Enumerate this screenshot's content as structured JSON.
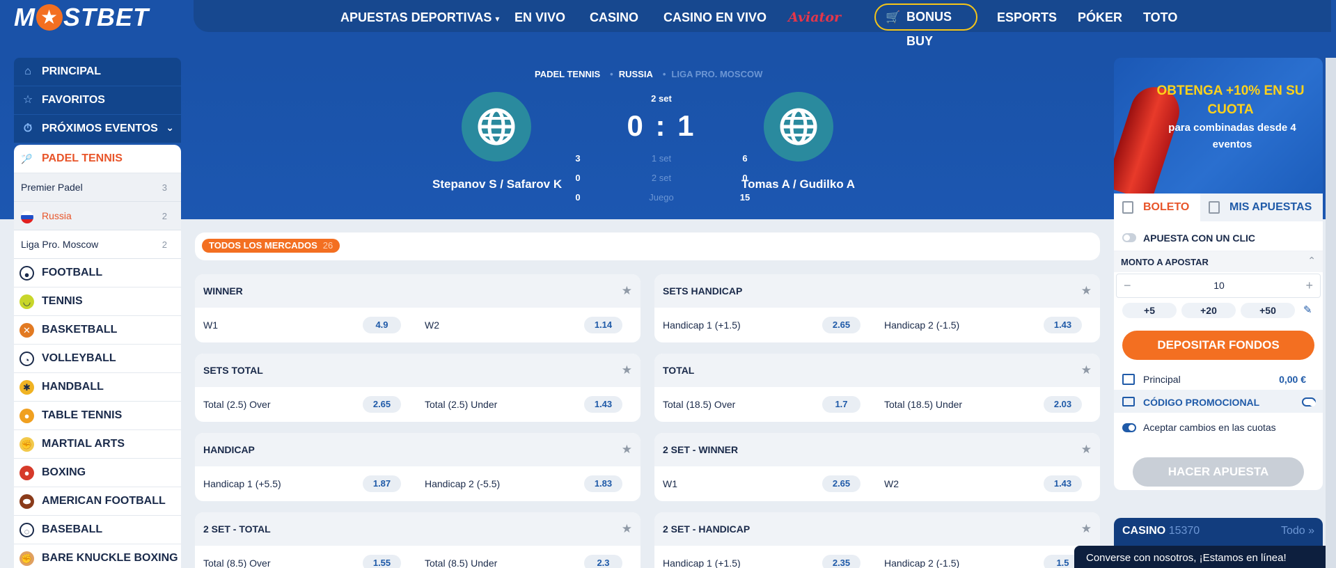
{
  "brand": {
    "logo_left": "M",
    "logo_right": "STBET",
    "accent": "#f36f21",
    "primary": "#1a52a8"
  },
  "nav": [
    {
      "label": "APUESTAS DEPORTIVAS",
      "chevron": "chevron-down-icon"
    },
    {
      "label": "EN VIVO"
    },
    {
      "label": "CASINO"
    },
    {
      "label": "CASINO EN VIVO"
    },
    {
      "label": "Aviator"
    },
    {
      "label": "BONUS BUY",
      "icon": "cart-icon"
    },
    {
      "label": "ESPORTS"
    },
    {
      "label": "PÓKER"
    },
    {
      "label": "TOTO"
    }
  ],
  "sidebar": {
    "top": [
      {
        "label": "PRINCIPAL",
        "icon": "home-icon"
      },
      {
        "label": "FAVORITOS",
        "icon": "star-icon"
      },
      {
        "label": "PRÓXIMOS EVENTOS",
        "icon": "stopwatch-icon"
      }
    ],
    "active_sport": "PADEL TENNIS",
    "sub": [
      {
        "label": "Premier Padel",
        "count": "3"
      },
      {
        "label": "Russia",
        "count": "2"
      },
      {
        "label": "Liga Pro. Moscow",
        "count": "2"
      }
    ],
    "sports": [
      {
        "label": "FOOTBALL",
        "icon": "football-icon"
      },
      {
        "label": "TENNIS",
        "icon": "tennis-icon"
      },
      {
        "label": "BASKETBALL",
        "icon": "basketball-icon"
      },
      {
        "label": "VOLLEYBALL",
        "icon": "volleyball-icon"
      },
      {
        "label": "HANDBALL",
        "icon": "handball-icon"
      },
      {
        "label": "TABLE TENNIS",
        "icon": "table-tennis-icon"
      },
      {
        "label": "MARTIAL ARTS",
        "icon": "martial-arts-icon"
      },
      {
        "label": "BOXING",
        "icon": "boxing-icon"
      },
      {
        "label": "AMERICAN FOOTBALL",
        "icon": "american-football-icon"
      },
      {
        "label": "BASEBALL",
        "icon": "baseball-icon"
      },
      {
        "label": "BARE KNUCKLE BOXING",
        "icon": "bare-knuckle-icon"
      }
    ]
  },
  "event": {
    "breadcrumbs": [
      "PADEL TENNIS",
      "RUSSIA",
      "LIGA PRO. MOSCOW"
    ],
    "team1": "Stepanov S / Safarov K",
    "team2": "Tomas A / Gudilko A",
    "current_set": "2 set",
    "score": "0 : 1",
    "rows": [
      {
        "l": "3",
        "label": "1 set",
        "r": "6"
      },
      {
        "l": "0",
        "label": "2 set",
        "r": "0"
      },
      {
        "l": "0",
        "label": "Juego",
        "r": "15"
      }
    ]
  },
  "markets": {
    "tab_label": "TODOS LOS MERCADOS",
    "tab_count": "26",
    "items": [
      {
        "title": "WINNER",
        "o1": "W1",
        "v1": "4.9",
        "o2": "W2",
        "v2": "1.14"
      },
      {
        "title": "SETS HANDICAP",
        "o1": "Handicap 1 (+1.5)",
        "v1": "2.65",
        "o2": "Handicap 2 (-1.5)",
        "v2": "1.43"
      },
      {
        "title": "SETS TOTAL",
        "o1": "Total (2.5) Over",
        "v1": "2.65",
        "o2": "Total (2.5) Under",
        "v2": "1.43"
      },
      {
        "title": "TOTAL",
        "o1": "Total (18.5) Over",
        "v1": "1.7",
        "o2": "Total (18.5) Under",
        "v2": "2.03"
      },
      {
        "title": "HANDICAP",
        "o1": "Handicap 1 (+5.5)",
        "v1": "1.87",
        "o2": "Handicap 2 (-5.5)",
        "v2": "1.83"
      },
      {
        "title": "2 SET - WINNER",
        "o1": "W1",
        "v1": "2.65",
        "o2": "W2",
        "v2": "1.43"
      },
      {
        "title": "2 SET - TOTAL",
        "o1": "Total (8.5) Over",
        "v1": "1.55",
        "o2": "Total (8.5) Under",
        "v2": "2.3"
      },
      {
        "title": "2 SET - HANDICAP",
        "o1": "Handicap 1 (+1.5)",
        "v1": "2.35",
        "o2": "Handicap 2 (-1.5)",
        "v2": "1.5"
      }
    ]
  },
  "promo": {
    "headline": "OBTENGA +10% EN SU CUOTA",
    "sub": "para combinadas desde 4 eventos"
  },
  "betslip": {
    "tab1": "BOLETO",
    "tab2": "MIS APUESTAS",
    "one_click": "APUESTA CON UN CLIC",
    "amount_label": "MONTO A APOSTAR",
    "amount": "10",
    "quick": [
      "+5",
      "+20",
      "+50"
    ],
    "deposit": "DEPOSITAR FONDOS",
    "balance_label": "Principal",
    "balance": "0,00 €",
    "promo_code": "CÓDIGO PROMOCIONAL",
    "accept_changes": "Aceptar cambios en las cuotas",
    "place_bet": "HACER APUESTA"
  },
  "casino": {
    "title": "CASINO",
    "count": "15370",
    "all": "Todo"
  },
  "chat": {
    "text": "Converse con nosotros, ¡Estamos en línea!"
  }
}
